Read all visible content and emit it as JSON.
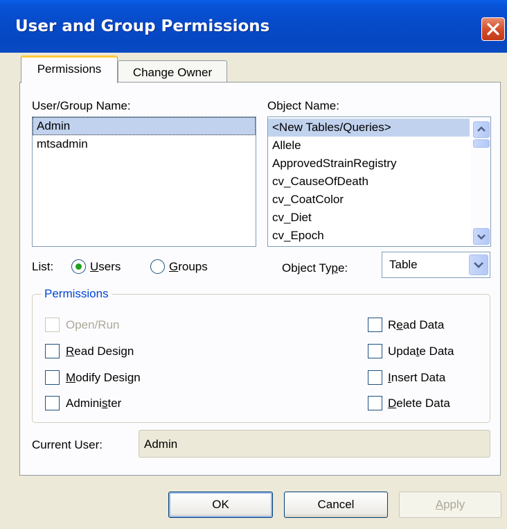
{
  "window": {
    "title": "User and Group Permissions"
  },
  "tabs": {
    "permissions": "Permissions",
    "change_owner": "Change Owner"
  },
  "user_group": {
    "label": "User/Group Name:",
    "items": [
      "Admin",
      "mtsadmin"
    ],
    "selected_index": 0
  },
  "object_name": {
    "label": "Object Name:",
    "items": [
      "<New Tables/Queries>",
      "Allele",
      "ApprovedStrainRegistry",
      "cv_CauseOfDeath",
      "cv_CoatColor",
      "cv_Diet",
      "cv_Epoch"
    ],
    "selected_index": 0
  },
  "list_filter": {
    "label": "List:",
    "users": "Users",
    "groups": "Groups",
    "selected": "Users"
  },
  "object_type": {
    "label": "Object Type:",
    "value": "Table"
  },
  "permissions": {
    "legend": "Permissions",
    "open_run": "Open/Run",
    "read_design": "Read Design",
    "modify_design": "Modify Design",
    "administer": "Administer",
    "read_data": "Read Data",
    "update_data": "Update Data",
    "insert_data": "Insert Data",
    "delete_data": "Delete Data"
  },
  "current_user": {
    "label": "Current User:",
    "value": "Admin"
  },
  "buttons": {
    "ok": "OK",
    "cancel": "Cancel",
    "apply": "Apply"
  },
  "colors": {
    "titlebar": "#0546c2",
    "selection": "#c1d2ee",
    "legend": "#0046d5"
  }
}
